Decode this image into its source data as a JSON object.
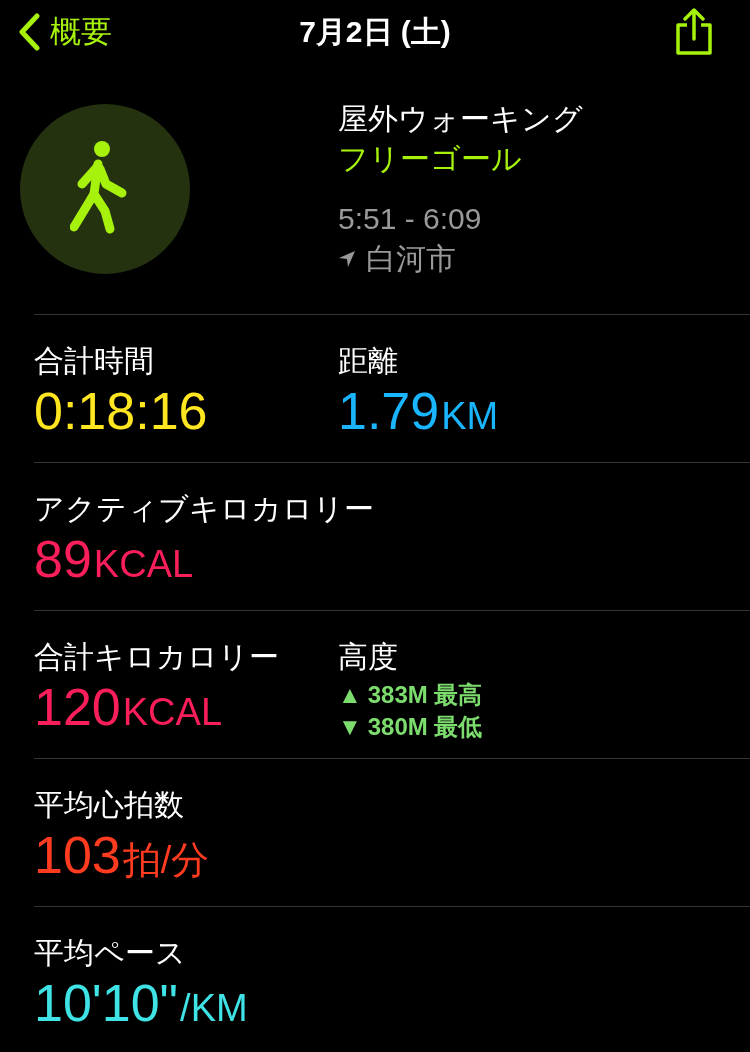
{
  "nav": {
    "back": "概要",
    "title": "7月2日 (土)"
  },
  "workout": {
    "name": "屋外ウォーキング",
    "goal": "フリーゴール",
    "time": "5:51 - 6:09",
    "place": "白河市"
  },
  "rows": [
    {
      "cells": [
        {
          "kind": "value",
          "label": "合計時間",
          "value": "0:18:16",
          "color": "#ffe620"
        },
        {
          "kind": "value",
          "label": "距離",
          "value": "1.79",
          "unit": "KM",
          "color": "#19b5fe"
        }
      ]
    },
    {
      "cells": [
        {
          "kind": "value",
          "label": "アクティブキロカロリー",
          "value": "89",
          "unit": "KCAL",
          "color": "#fa1e5a"
        }
      ]
    },
    {
      "cells": [
        {
          "kind": "value",
          "label": "合計キロカロリー",
          "value": "120",
          "unit": "KCAL",
          "color": "#fa1e5a"
        },
        {
          "kind": "elevation",
          "label": "高度",
          "color": "#7ddc6e",
          "lines": [
            {
              "arrow": "▲",
              "text": "383M 最高"
            },
            {
              "arrow": "▼",
              "text": "380M 最低"
            }
          ]
        }
      ]
    },
    {
      "cells": [
        {
          "kind": "value",
          "label": "平均心拍数",
          "value": "103",
          "unit": "拍/分",
          "color": "#ff3b20"
        }
      ]
    },
    {
      "cells": [
        {
          "kind": "value",
          "label": "平均ペース",
          "value": "10'10\"",
          "unit": "/KM",
          "color": "#3fe3e6"
        }
      ]
    }
  ]
}
